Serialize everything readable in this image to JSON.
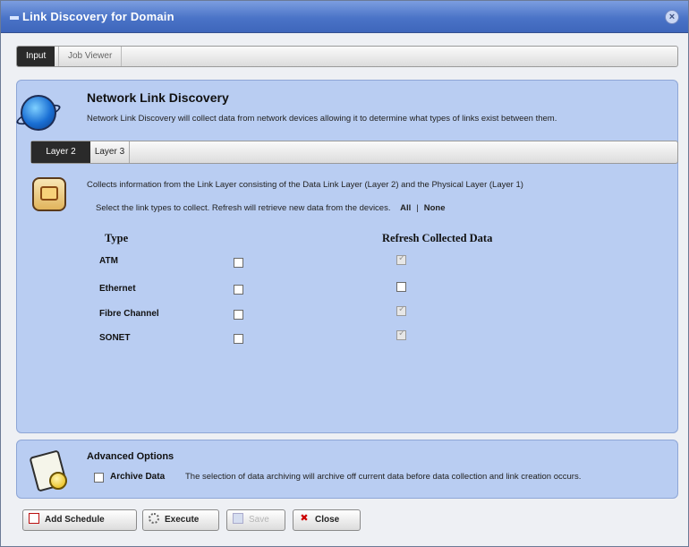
{
  "window": {
    "title": "Link Discovery for Domain",
    "close_glyph": "×"
  },
  "outer_tabs": [
    {
      "label": "Input",
      "active": true
    },
    {
      "label": "Job Viewer",
      "active": false
    }
  ],
  "section": {
    "icon": "globe-icon",
    "heading": "Network Link Discovery",
    "description": "Network Link Discovery will collect data from network devices allowing it to determine what types of links exist between them."
  },
  "inner_tabs": [
    {
      "label": "Layer 2",
      "active": true
    },
    {
      "label": "Layer 3",
      "active": false
    }
  ],
  "layer2": {
    "icon": "layer-chip-icon",
    "info": "Collects information from the Link Layer consisting of the Data Link Layer (Layer 2) and the Physical Layer (Layer 1)",
    "select_text": "Select the link types to collect. Refresh will retrieve new data from the devices.",
    "all_link": "All",
    "separator": "|",
    "none_link": "None",
    "col_type": "Type",
    "col_refresh": "Refresh Collected Data",
    "rows": [
      {
        "type": "ATM",
        "collect": false,
        "refresh": true,
        "refresh_disabled": true
      },
      {
        "type": "Ethernet",
        "collect": false,
        "refresh": false,
        "refresh_disabled": false
      },
      {
        "type": "Fibre Channel",
        "collect": false,
        "refresh": true,
        "refresh_disabled": true
      },
      {
        "type": "SONET",
        "collect": false,
        "refresh": true,
        "refresh_disabled": true
      }
    ]
  },
  "advanced": {
    "icon": "archive-icon",
    "title": "Advanced Options",
    "archive_label": "Archive Data",
    "archive_checked": false,
    "archive_desc": "The selection of data archiving will archive off current data before data collection and link creation occurs."
  },
  "buttons": {
    "add_schedule": "Add Schedule",
    "execute": "Execute",
    "save": "Save",
    "close": "Close"
  },
  "colors": {
    "panel_bg": "#b9cdf2",
    "titlebar": "#4a73c7",
    "active_tab": "#2a2a2a"
  }
}
